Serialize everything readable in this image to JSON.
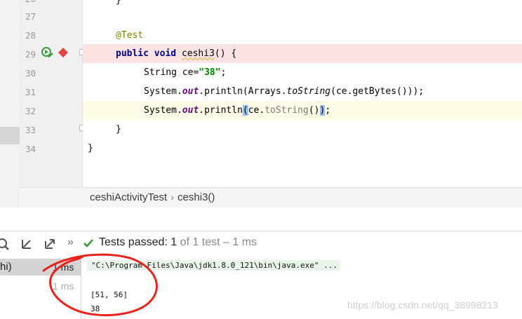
{
  "editor": {
    "lines": [
      {
        "num": "27",
        "code": ""
      },
      {
        "num": "28",
        "annotation": "@Test"
      },
      {
        "num": "29",
        "kw1": "public",
        "kw2": "void",
        "method": "ceshi3",
        "rest": "() {"
      },
      {
        "num": "30",
        "type": "String",
        "var": " ce=",
        "str": "\"38\"",
        "end": ";"
      },
      {
        "num": "31",
        "p1": "System.",
        "out": "out",
        "p2": ".println(Arrays.",
        "fn": "toString",
        "p3": "(ce.getBytes()));"
      },
      {
        "num": "32",
        "p1": "System.",
        "out": "out",
        "p2": ".println",
        "lp": "(",
        "p3": "ce.",
        "fn": "toString",
        "p4": "()",
        "rp": ")",
        "end": ";"
      },
      {
        "num": "33",
        "code": "}"
      },
      {
        "num": "34",
        "code": "}"
      }
    ]
  },
  "breadcrumb": {
    "class_name": "ceshiActivityTest",
    "separator": "›",
    "method_name": "ceshi3()"
  },
  "run": {
    "status_label": "Tests passed:",
    "passed_count": "1",
    "of_text": "of 1 test – 1 ms",
    "colors": {
      "pass": "#3c9a3c",
      "breakpoint": "#e04545",
      "annotation_circle": "#e8231c"
    }
  },
  "tree": {
    "item_label": "hi)",
    "item_time": "1 ms",
    "sub_time": "1 ms"
  },
  "console": {
    "command": "\"C:\\Program Files\\Java\\jdk1.8.0_121\\bin\\java.exe\" ...",
    "output_line1": "[51, 56]",
    "output_line2": "38"
  },
  "watermark": "https://blog.csdn.net/qq_38998213",
  "icons": [
    "run-passed-icon",
    "breakpoint-icon",
    "zoom-icon",
    "collapse-icon",
    "expand-icon",
    "more-icon",
    "check-icon"
  ]
}
